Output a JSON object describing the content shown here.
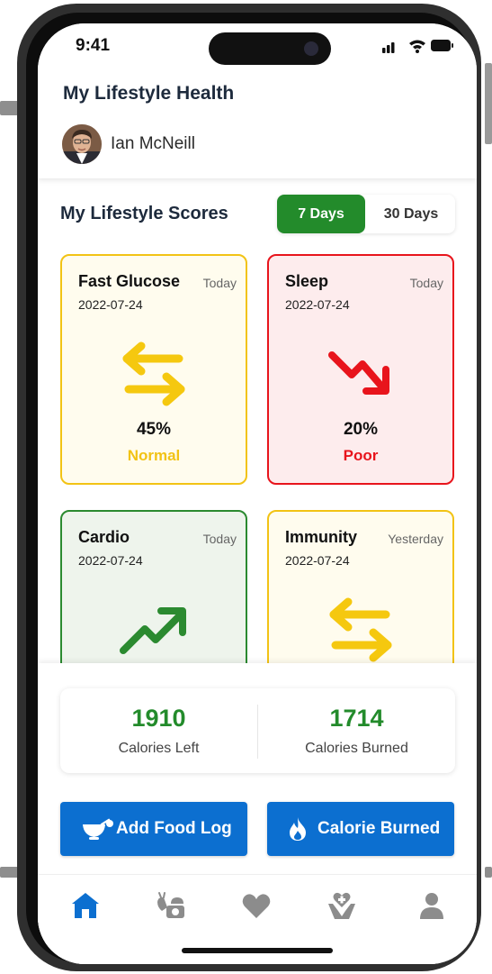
{
  "status_bar": {
    "time": "9:41"
  },
  "header": {
    "title": "My Lifestyle Health",
    "user_name": "Ian McNeill"
  },
  "scores": {
    "title": "My Lifestyle Scores",
    "range_options": [
      "7 Days",
      "30 Days"
    ],
    "selected_range": "7 Days",
    "cards": [
      {
        "title": "Fast Glucose",
        "when": "Today",
        "date": "2022-07-24",
        "percent": "45%",
        "status": "Normal",
        "trend_icon": "swap-arrows-icon",
        "color": "#f2c315",
        "status_color": "#f2c315"
      },
      {
        "title": "Sleep",
        "when": "Today",
        "date": "2022-07-24",
        "percent": "20%",
        "status": "Poor",
        "trend_icon": "trend-down-icon",
        "color": "#e8141c",
        "status_color": "#e8141c"
      },
      {
        "title": "Cardio",
        "when": "Today",
        "date": "2022-07-24",
        "trend_icon": "trend-up-icon",
        "color": "#2b8a30"
      },
      {
        "title": "Immunity",
        "when": "Yesterday",
        "date": "2022-07-24",
        "trend_icon": "swap-arrows-icon",
        "color": "#f2c315"
      }
    ]
  },
  "calories": {
    "left_value": "1910",
    "left_label": "Calories Left",
    "burned_value": "1714",
    "burned_label": "Calories Burned"
  },
  "actions": {
    "add_food": {
      "label": "Add Food Log",
      "icon": "food-bowl-icon"
    },
    "calorie_burned": {
      "label": "Calorie Burned",
      "icon": "flame-icon"
    }
  },
  "tabbar": {
    "items": [
      "home-icon",
      "nutrition-scale-icon",
      "heart-icon",
      "health-hands-icon",
      "profile-icon"
    ],
    "active": "home-icon",
    "active_color": "#0c6fd0",
    "inactive_color": "#8c8c8c"
  },
  "colors": {
    "primary_green": "#238b2b",
    "primary_blue": "#0c6fd0",
    "title_text": "#1d2a3c"
  }
}
